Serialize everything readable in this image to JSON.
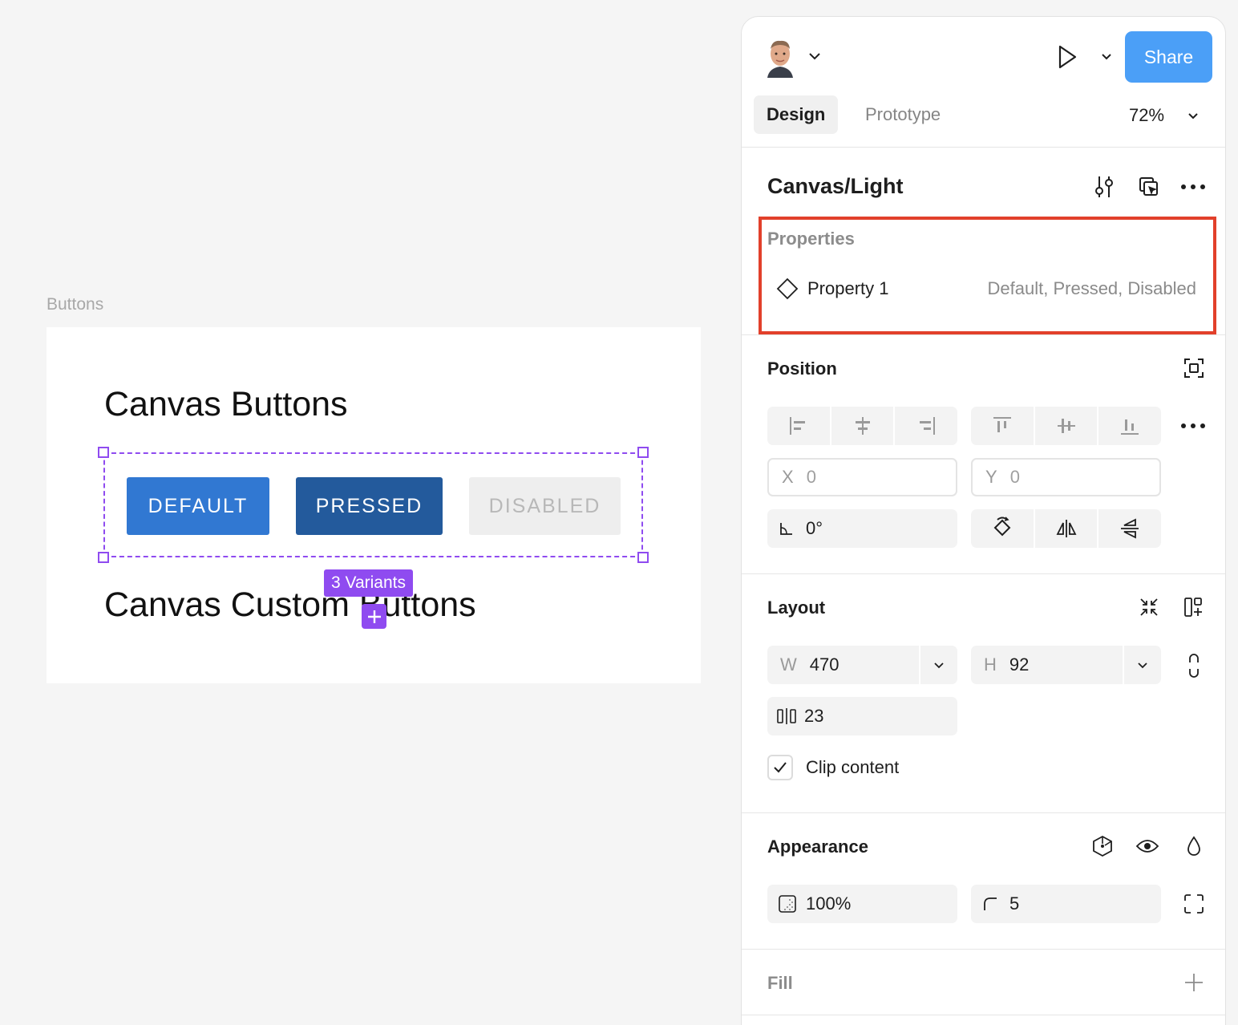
{
  "canvas": {
    "frame_label": "Buttons",
    "heading_1": "Canvas Buttons",
    "heading_2": "Canvas Custom Buttons",
    "buttons": {
      "default": "DEFAULT",
      "pressed": "PRESSED",
      "disabled": "DISABLED"
    },
    "variants_badge": "3 Variants",
    "selection_color": "#8f4bf0"
  },
  "panel": {
    "share_label": "Share",
    "tabs": {
      "design": "Design",
      "prototype": "Prototype"
    },
    "zoom": "72%",
    "component_name": "Canvas/Light",
    "properties": {
      "title": "Properties",
      "items": [
        {
          "name": "Property 1",
          "value": "Default, Pressed, Disabled"
        }
      ]
    },
    "position": {
      "title": "Position",
      "x_label": "X",
      "x_value": "0",
      "y_label": "Y",
      "y_value": "0",
      "rotation": "0°"
    },
    "layout": {
      "title": "Layout",
      "w_label": "W",
      "w_value": "470",
      "h_label": "H",
      "h_value": "92",
      "gap": "23",
      "clip_content_label": "Clip content",
      "clip_content_checked": true
    },
    "appearance": {
      "title": "Appearance",
      "opacity": "100%",
      "radius": "5"
    },
    "fill": {
      "title": "Fill"
    },
    "colors": {
      "share_bg": "#4b9ff7",
      "highlight_border": "#e2402b",
      "default_button": "#3178d2",
      "pressed_button": "#235a9c",
      "disabled_button": "#eeeeee"
    },
    "icons": [
      "avatar",
      "chevron-down-icon",
      "play-icon",
      "component-settings-icon",
      "select-instances-icon",
      "more-icon",
      "component-property-icon",
      "focus-icon",
      "align-left-icon",
      "align-center-h-icon",
      "align-right-icon",
      "align-top-icon",
      "align-middle-v-icon",
      "align-bottom-icon",
      "rotation-icon",
      "rotate-90-icon",
      "flip-horizontal-icon",
      "flip-vertical-icon",
      "collapse-icon",
      "auto-layout-icon",
      "constrain-proportions-icon",
      "gap-icon",
      "check-icon",
      "component-icon",
      "eye-icon",
      "drop-icon",
      "opacity-icon",
      "corner-radius-icon",
      "independent-corners-icon",
      "plus-icon"
    ]
  }
}
